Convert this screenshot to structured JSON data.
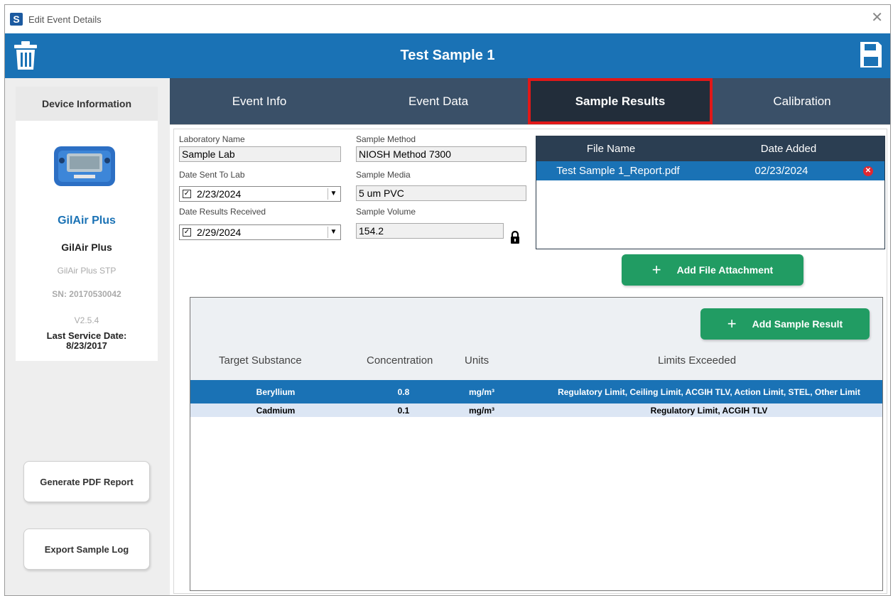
{
  "window": {
    "title": "Edit Event Details",
    "app_icon": "S"
  },
  "header": {
    "title": "Test Sample 1"
  },
  "sidebar": {
    "heading": "Device Information",
    "device_name_blue": "GilAir Plus",
    "device_name": "GilAir Plus",
    "model": "GilAir Plus STP",
    "serial": "SN: 20170530042",
    "version": "V2.5.4",
    "service_label": "Last Service Date:",
    "service_date": "8/23/2017",
    "pdf_button": "Generate PDF Report",
    "log_button": "Export Sample Log"
  },
  "tabs": [
    {
      "label": "Event Info",
      "active": false
    },
    {
      "label": "Event Data",
      "active": false
    },
    {
      "label": "Sample Results",
      "active": true
    },
    {
      "label": "Calibration",
      "active": false
    }
  ],
  "form": {
    "lab_name_label": "Laboratory Name",
    "lab_name": "Sample Lab",
    "sent_label": "Date Sent To Lab",
    "sent_date": "2/23/2024",
    "received_label": "Date Results Received",
    "received_date": "2/29/2024",
    "method_label": "Sample Method",
    "method": "NIOSH Method 7300",
    "media_label": "Sample Media",
    "media": "5 um PVC",
    "volume_label": "Sample Volume",
    "volume": "154.2"
  },
  "files": {
    "col_name": "File Name",
    "col_date": "Date Added",
    "rows": [
      {
        "name": "Test Sample 1_Report.pdf",
        "date": "02/23/2024"
      }
    ],
    "add_button": "Add File Attachment"
  },
  "results": {
    "add_button": "Add Sample Result",
    "headers": {
      "substance": "Target Substance",
      "concentration": "Concentration",
      "units": "Units",
      "limits": "Limits Exceeded"
    },
    "rows": [
      {
        "substance": "Beryllium",
        "concentration": "0.8",
        "units": "mg/m³",
        "limits": "Regulatory Limit, Ceiling Limit, ACGIH TLV, Action Limit, STEL, Other Limit"
      },
      {
        "substance": "Cadmium",
        "concentration": "0.1",
        "units": "mg/m³",
        "limits": "Regulatory Limit, ACGIH TLV"
      }
    ]
  },
  "colors": {
    "header_blue": "#1a72b5",
    "tab_bar": "#3a5068",
    "active_tab": "#222d3a",
    "highlight_red": "#e01818",
    "green": "#219c63"
  }
}
